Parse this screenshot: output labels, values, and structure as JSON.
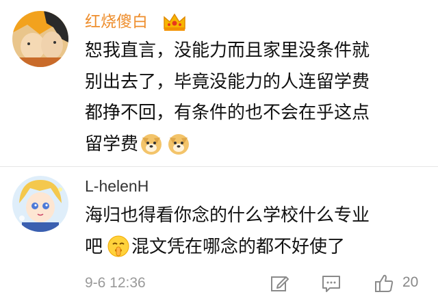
{
  "comments": [
    {
      "username": "红烧傻白",
      "badge_icon": "vip-crown-icon",
      "lines": [
        "恕我直言，没能力而且家里没条件就",
        "别出去了，毕竟没能力的人连留学费",
        "都挣不回，有条件的也不会在乎这点"
      ],
      "last_line_text": "留学费",
      "last_line_emojis": [
        "doge-emoji",
        "doge-emoji"
      ]
    },
    {
      "username": "L-helenH",
      "lines": [
        "海归也得看你念的什么学校什么专业"
      ],
      "second_line_prefix": "吧",
      "second_line_emoji": "shush-face-emoji",
      "second_line_text": "混文凭在哪念的都不好使了"
    }
  ],
  "footer": {
    "timestamp": "9-6 12:36",
    "repost_icon": "repost-edit-icon",
    "reply_icon": "comment-icon",
    "like_icon": "thumbs-up-icon",
    "like_count": "20"
  },
  "colors": {
    "vip_name": "#ee8d2b",
    "text": "#111111",
    "meta": "#999999"
  }
}
